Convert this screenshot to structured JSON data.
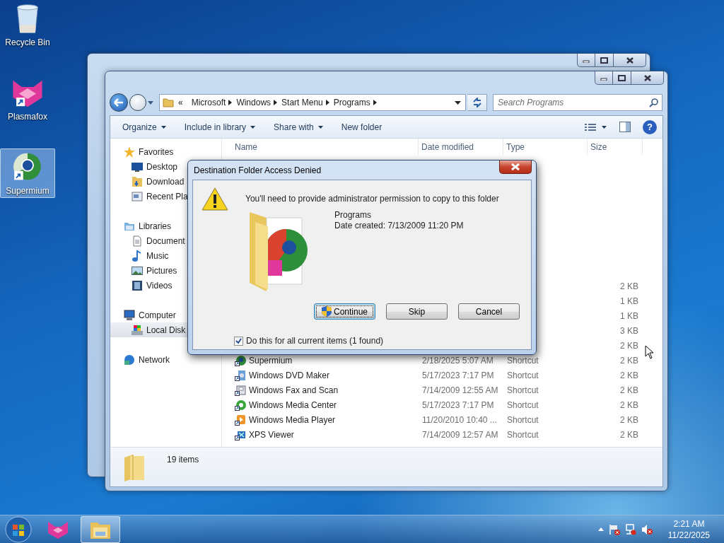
{
  "desktop_icons": [
    {
      "label": "Recycle Bin",
      "kind": "recycle",
      "selected": false
    },
    {
      "label": "Plasmafox",
      "kind": "plasmafox",
      "selected": false
    },
    {
      "label": "Supermium",
      "kind": "supermium",
      "selected": true
    }
  ],
  "explorer": {
    "address": {
      "overflow": "«",
      "crumbs": [
        "Microsoft",
        "Windows",
        "Start Menu",
        "Programs"
      ]
    },
    "search": {
      "placeholder": "Search Programs"
    },
    "toolbar": [
      {
        "label": "Organize",
        "dropdown": true
      },
      {
        "label": "Include in library",
        "dropdown": true
      },
      {
        "label": "Share with",
        "dropdown": true
      },
      {
        "label": "New folder",
        "dropdown": false
      }
    ],
    "nav": [
      {
        "label": "Favorites",
        "kind": "star",
        "selected": false,
        "children": [
          {
            "label": "Desktop",
            "kind": "monitor",
            "selected": false
          },
          {
            "label": "Download",
            "kind": "downloads",
            "selected": false
          },
          {
            "label": "Recent Pla",
            "kind": "recent",
            "selected": false
          }
        ]
      },
      {
        "label": "Libraries",
        "kind": "library",
        "selected": false,
        "children": [
          {
            "label": "Document",
            "kind": "document",
            "selected": false
          },
          {
            "label": "Music",
            "kind": "music",
            "selected": false
          },
          {
            "label": "Pictures",
            "kind": "pictures",
            "selected": false
          },
          {
            "label": "Videos",
            "kind": "videos",
            "selected": false
          }
        ]
      },
      {
        "label": "Computer",
        "kind": "computer",
        "selected": false,
        "children": [
          {
            "label": "Local Disk",
            "kind": "disk",
            "selected": true
          }
        ]
      },
      {
        "label": "Network",
        "kind": "network",
        "selected": false
      }
    ],
    "help": "?",
    "columns": [
      "Name",
      "Date modified",
      "Type",
      "Size"
    ],
    "rows": [
      {
        "size": "2 KB"
      },
      {
        "size": "1 KB"
      },
      {
        "size": "1 KB"
      },
      {
        "size": "3 KB"
      },
      {
        "size": "2 KB"
      },
      {
        "name": "Supermium",
        "date": "2/18/2025 5:07 AM",
        "type": "Shortcut",
        "size": "2 KB",
        "kind": "supermium"
      },
      {
        "name": "Windows DVD Maker",
        "date": "5/17/2023 7:17 PM",
        "type": "Shortcut",
        "size": "2 KB",
        "kind": "dvd"
      },
      {
        "name": "Windows Fax and Scan",
        "date": "7/14/2009 12:55 AM",
        "type": "Shortcut",
        "size": "2 KB",
        "kind": "fax"
      },
      {
        "name": "Windows Media Center",
        "date": "5/17/2023 7:17 PM",
        "type": "Shortcut",
        "size": "2 KB",
        "kind": "mediacenter"
      },
      {
        "name": "Windows Media Player",
        "date": "11/20/2010 10:40 ...",
        "type": "Shortcut",
        "size": "2 KB",
        "kind": "mediaplayer"
      },
      {
        "name": "XPS Viewer",
        "date": "7/14/2009 12:57 AM",
        "type": "Shortcut",
        "size": "2 KB",
        "kind": "xps"
      }
    ],
    "status": "19 items"
  },
  "dialog": {
    "title": "Destination Folder Access Denied",
    "message": "You'll need to provide administrator permission to copy to this folder",
    "folder_name": "Programs",
    "date_created": "Date created: 7/13/2009 11:20 PM",
    "buttons": [
      {
        "label": "Continue",
        "shield": true,
        "default": true
      },
      {
        "label": "Skip",
        "shield": false,
        "default": false
      },
      {
        "label": "Cancel",
        "shield": false,
        "default": false
      }
    ],
    "checkbox": {
      "label": "Do this for all current items (1 found)",
      "checked": true
    }
  },
  "taskbar": {
    "apps": [
      {
        "kind": "plasmafox",
        "active": false
      },
      {
        "kind": "explorer",
        "active": true
      }
    ],
    "time": "2:21 AM",
    "date": "11/22/2025"
  }
}
